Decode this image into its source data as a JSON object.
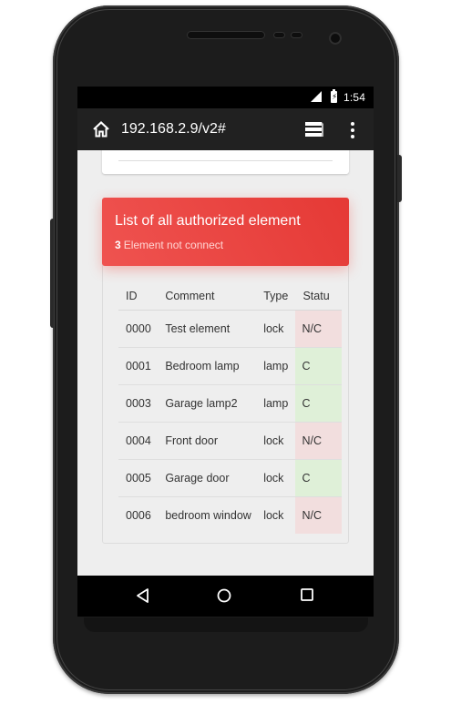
{
  "status_bar": {
    "network": "4G",
    "time": "1:54"
  },
  "toolbar": {
    "url": "192.168.2.9/v2#",
    "home_icon": "home-icon",
    "tabs_icon": "tabs-icon",
    "menu_icon": "more-vert-icon"
  },
  "card": {
    "title": "List of all authorized element",
    "subtitle_count": "3",
    "subtitle_text": "Element not connect",
    "accent": "#e53935"
  },
  "table": {
    "headers": [
      "ID",
      "Comment",
      "Type",
      "Statu"
    ],
    "rows": [
      {
        "id": "0000",
        "comment": "Test element",
        "type": "lock",
        "status": "N/C"
      },
      {
        "id": "0001",
        "comment": "Bedroom lamp",
        "type": "lamp",
        "status": "C"
      },
      {
        "id": "0003",
        "comment": "Garage lamp2",
        "type": "lamp",
        "status": "C"
      },
      {
        "id": "0004",
        "comment": "Front door",
        "type": "lock",
        "status": "N/C"
      },
      {
        "id": "0005",
        "comment": "Garage door",
        "type": "lock",
        "status": "C"
      },
      {
        "id": "0006",
        "comment": "bedroom window",
        "type": "lock",
        "status": "N/C"
      }
    ],
    "status_colors": {
      "connected": "#dff0d8",
      "not_connected": "#f2dede"
    }
  },
  "navbar": {
    "back_icon": "back-triangle-icon",
    "home_icon": "home-circle-icon",
    "recents_icon": "recents-square-icon"
  }
}
